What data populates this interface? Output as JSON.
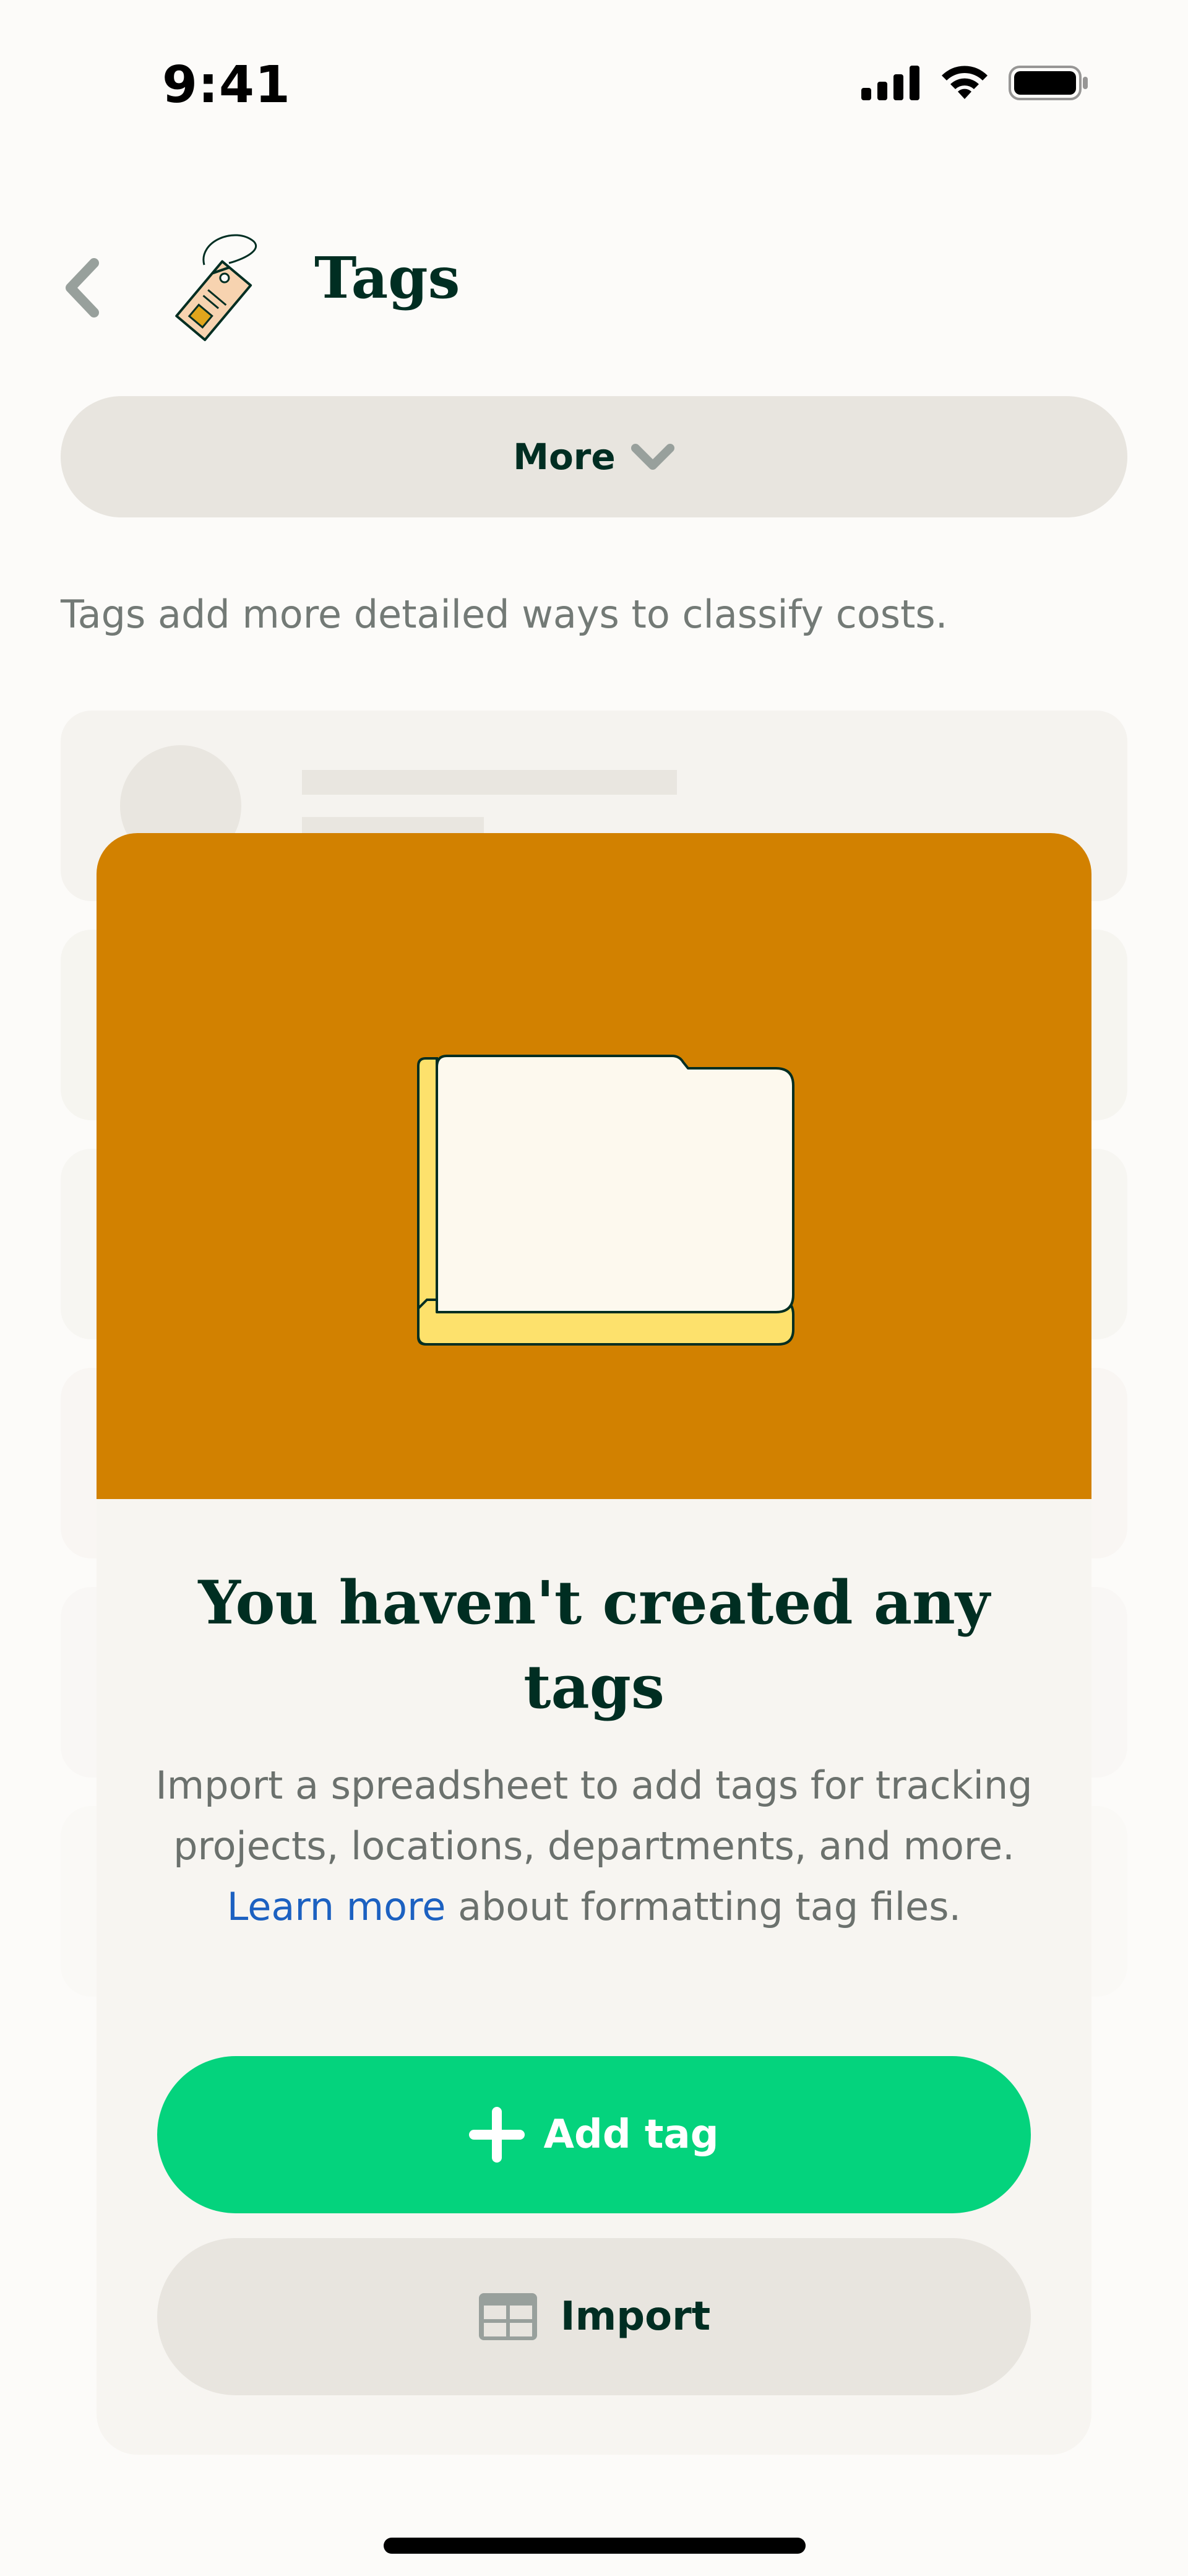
{
  "status_bar": {
    "time": "9:41",
    "icons": [
      "cellular-signal-icon",
      "wifi-icon",
      "battery-icon"
    ]
  },
  "header": {
    "back_icon": "chevron-left-icon",
    "illustration": "price-tag-illustration",
    "title": "Tags"
  },
  "more_button": {
    "label": "More",
    "icon": "chevron-down-icon"
  },
  "description": "Tags add more detailed ways to classify costs.",
  "empty_state": {
    "illustration": "folder-illustration",
    "heading": "You haven't created any tags",
    "body_before_link": "Import a spreadsheet to add tags for tracking projects, locations, departments, and more. ",
    "link_text": "Learn more",
    "body_after_link": " about formatting tag files.",
    "primary_button": {
      "label": "Add tag",
      "icon": "plus-icon"
    },
    "secondary_button": {
      "label": "Import",
      "icon": "table-grid-icon"
    }
  },
  "colors": {
    "background": "#fcfbf9",
    "text_dark": "#002e22",
    "text_muted": "#737a76",
    "hero_orange": "#d28100",
    "primary_green": "#04d37d",
    "button_neutral": "#e8e5df",
    "link_blue": "#1c61c1",
    "folder_yellow": "#fde16c"
  }
}
